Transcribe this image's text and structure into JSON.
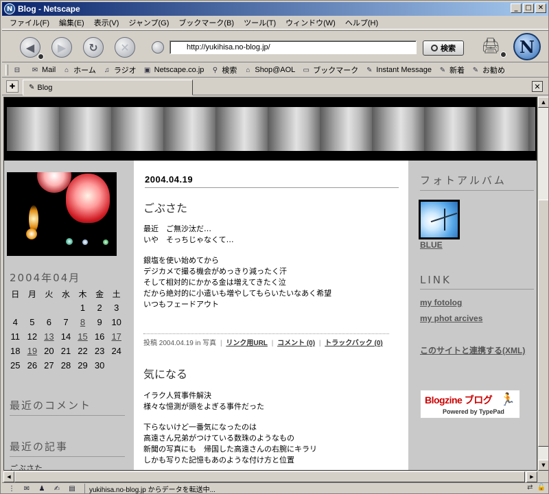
{
  "window": {
    "title": "Blog - Netscape",
    "app_icon": "N"
  },
  "menu": [
    "ファイル(F)",
    "編集(E)",
    "表示(V)",
    "ジャンプ(G)",
    "ブックマーク(B)",
    "ツール(T)",
    "ウィンドウ(W)",
    "ヘルプ(H)"
  ],
  "nav": {
    "url": "http://yukihisa.no-blog.jp/",
    "search_label": "検索"
  },
  "personal_toolbar": [
    {
      "label": "Mail",
      "icon": "mail-icon"
    },
    {
      "label": "ホーム",
      "icon": "home-icon"
    },
    {
      "label": "ラジオ",
      "icon": "radio-icon"
    },
    {
      "label": "Netscape.co.jp",
      "icon": "netscape-icon"
    },
    {
      "label": "検索",
      "icon": "search-icon"
    },
    {
      "label": "Shop@AOL",
      "icon": "shop-icon"
    },
    {
      "label": "ブックマーク",
      "icon": "bookmark-folder-icon"
    },
    {
      "label": "Instant Message",
      "icon": "bookmark-icon"
    },
    {
      "label": "新着",
      "icon": "bookmark-icon"
    },
    {
      "label": "お勧め",
      "icon": "bookmark-icon"
    }
  ],
  "tab": {
    "label": "Blog"
  },
  "calendar": {
    "title": "2004年04月",
    "weekdays": [
      "日",
      "月",
      "火",
      "水",
      "木",
      "金",
      "土"
    ],
    "weeks": [
      [
        "",
        "",
        "",
        "",
        "1",
        "2",
        "3"
      ],
      [
        "4",
        "5",
        "6",
        "7",
        "8",
        "9",
        "10"
      ],
      [
        "11",
        "12",
        "13",
        "14",
        "15",
        "16",
        "17"
      ],
      [
        "18",
        "19",
        "20",
        "21",
        "22",
        "23",
        "24"
      ],
      [
        "25",
        "26",
        "27",
        "28",
        "29",
        "30",
        ""
      ]
    ],
    "linked_days": [
      "8",
      "13",
      "15",
      "17",
      "19"
    ]
  },
  "left": {
    "recent_comments": "最近のコメント",
    "recent_posts": "最近の記事",
    "recent_first": "ごぶさた"
  },
  "main": {
    "date": "2004.04.19",
    "post1": {
      "title": "ごぶさた",
      "paragraphs": [
        [
          "最近　ご無沙汰だ…",
          "いや　そっちじゃなくて…"
        ],
        [
          "銀塩を使い始めてから",
          "デジカメで撮る機会がめっきり減ったく汗",
          "そして相対的にかかる金は増えてきたく泣",
          "だから絶対的に小遣いも増やしてもらいたいなあく希望",
          "いつもフェードアウト"
        ]
      ],
      "meta_prefix": "投稿 2004.04.19 in 写真",
      "link1": "リンク用URL",
      "link2": "コメント (0)",
      "link3": "トラックバック (0)"
    },
    "post2": {
      "title": "気になる",
      "paragraphs": [
        [
          "イラク人質事件解決",
          "様々な憶測が頭をよぎる事件だった"
        ],
        [
          "下らないけど一番気になったのは",
          "高遠さん兄弟がつけている数珠のようなもの",
          "新聞の写真にも　帰国した高遠さんの右腕にキラリ",
          "しかも写りた記憶もあのような付け方と位置"
        ]
      ]
    }
  },
  "right": {
    "album_head": "フォトアルバム",
    "album_label": "BLUE",
    "link_head": "LINK",
    "links": [
      "my fotolog",
      "my phot arcives"
    ],
    "xml_link": "このサイトと連携する(XML)",
    "banner_line1": "Blogzine ブログ",
    "banner_line2": "Powered by TypePad"
  },
  "status": {
    "text": "yukihisa.no-blog.jp からデータを転送中..."
  }
}
